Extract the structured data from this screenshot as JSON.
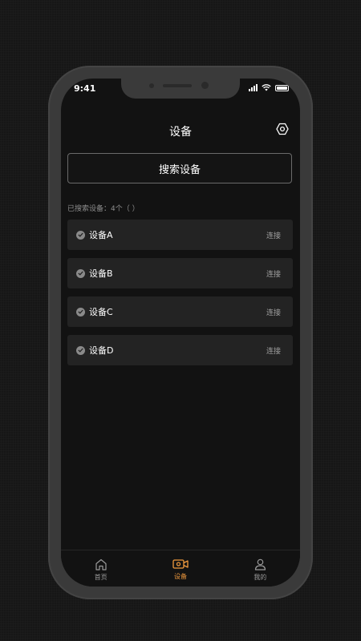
{
  "status_bar": {
    "time": "9:41"
  },
  "header": {
    "title": "设备"
  },
  "search_button": {
    "label": "搜索设备"
  },
  "found_text": "已搜索设备：4个（ ）",
  "devices": [
    {
      "name": "设备A",
      "action": "连接"
    },
    {
      "name": "设备B",
      "action": "连接"
    },
    {
      "name": "设备C",
      "action": "连接"
    },
    {
      "name": "设备D",
      "action": "连接"
    }
  ],
  "tabs": [
    {
      "label": "首页",
      "icon": "home-icon",
      "active": false
    },
    {
      "label": "设备",
      "icon": "camera-icon",
      "active": true
    },
    {
      "label": "我的",
      "icon": "user-icon",
      "active": false
    }
  ],
  "colors": {
    "accent": "#f09a3e",
    "background": "#121212",
    "card": "#232323"
  }
}
